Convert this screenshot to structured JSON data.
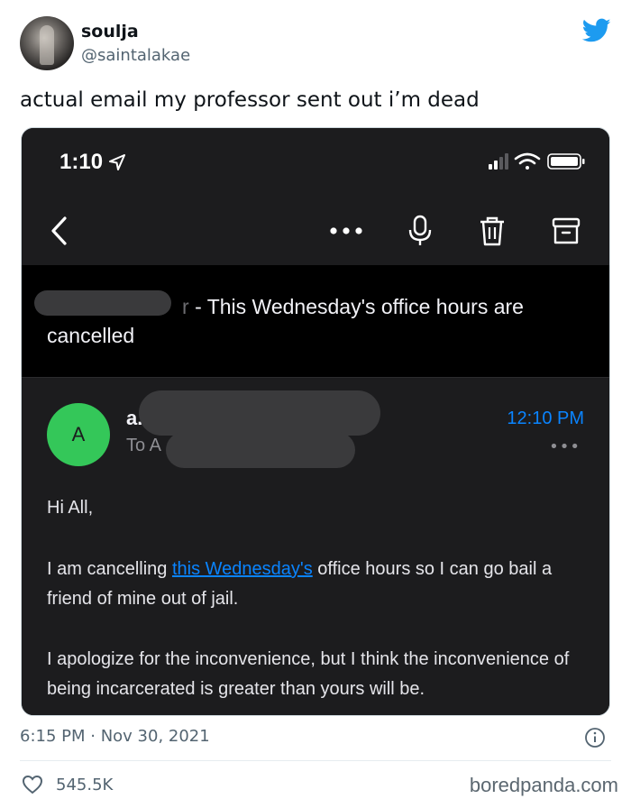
{
  "tweet": {
    "display_name": "soulja",
    "handle": "@saintalakae",
    "text": "actual email my professor sent out i’m dead",
    "timestamp": "6:15 PM · Nov 30, 2021",
    "likes": "545.5K",
    "brand_color": "#1d9bf0"
  },
  "phone": {
    "status_time": "1:10",
    "email": {
      "subject": "- This Wednesday's office hours are cancelled",
      "subject_prefix_partial": "r",
      "sender_avatar_letter": "A",
      "sender_name_partial": "a.",
      "recipients_partial": "To A",
      "sent_time": "12:10 PM",
      "greeting": "Hi All,",
      "para1_before_link": "I am cancelling ",
      "para1_link": "this Wednesday's",
      "para1_after_link": " office hours so I can go bail a friend of mine out of jail.",
      "para2": "I apologize for the inconvenience, but I think the inconvenience of being incarcerated is greater than yours will be.",
      "more_label": "•••"
    }
  },
  "watermark": "boredpanda.com",
  "icons": [
    "twitter-bird-icon",
    "location-arrow-icon",
    "signal-icon",
    "wifi-icon",
    "battery-icon",
    "back-chevron-icon",
    "more-options-icon",
    "microphone-icon",
    "trash-icon",
    "archive-icon",
    "info-icon",
    "heart-icon"
  ]
}
